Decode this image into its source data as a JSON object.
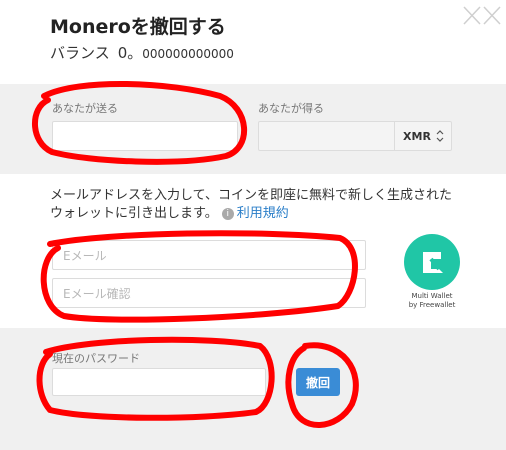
{
  "dialog": {
    "title": "Moneroを撤回する",
    "balance_label": "バランス",
    "balance_int": "0",
    "balance_sep": "。",
    "balance_dec": "000000000000"
  },
  "exchange": {
    "send_label": "あなたが送る",
    "send_value": "",
    "receive_label": "あなたが得る",
    "receive_value": "",
    "currency": "XMR"
  },
  "wallet": {
    "note": "メールアドレスを入力して、コインを即座に無料で新しく生成されたウォレットに引き出します。",
    "terms_link": "利用規約",
    "email_placeholder": "Eメール",
    "email_confirm_placeholder": "Eメール確認",
    "logo_line1": "Multi Wallet",
    "logo_line2": "by Freewallet"
  },
  "auth": {
    "password_label": "現在のパスワード",
    "password_value": "",
    "submit_label": "撤回"
  },
  "colors": {
    "accent": "#3a8cd6",
    "logo": "#20c6a6",
    "annotation": "#ff0000"
  },
  "icons": [
    "close-icon",
    "info-icon",
    "sort-arrows-icon",
    "freewallet-logo-icon"
  ]
}
